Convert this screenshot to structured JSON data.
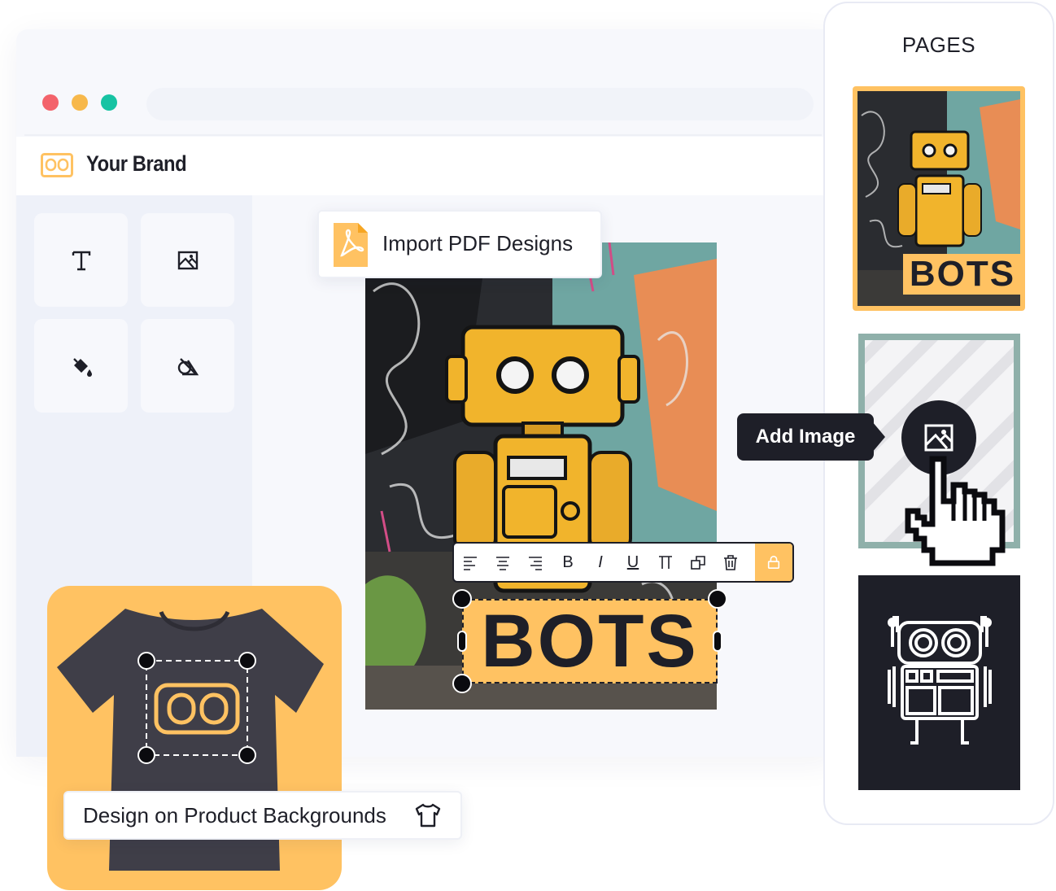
{
  "window": {
    "traffic_lights": [
      "#f3636b",
      "#f7b84b",
      "#17c3a3"
    ]
  },
  "brand": {
    "name": "Your Brand",
    "logo_icon": "robot-eyes-logo-icon",
    "accent": "#ffc262"
  },
  "sidebar": {
    "tools": [
      {
        "icon": "text-tool-icon",
        "glyph": "T"
      },
      {
        "icon": "image-tool-icon"
      },
      {
        "icon": "paint-bucket-icon"
      },
      {
        "icon": "shapes-icon"
      }
    ]
  },
  "import_chip": {
    "label": "Import PDF Designs",
    "icon": "pdf-file-icon"
  },
  "text_toolbar": {
    "buttons": [
      {
        "name": "align-left-button",
        "icon": "align-left-icon"
      },
      {
        "name": "align-center-button",
        "icon": "align-center-icon"
      },
      {
        "name": "align-right-button",
        "icon": "align-right-icon"
      },
      {
        "name": "bold-button",
        "label": "B"
      },
      {
        "name": "italic-button",
        "label": "I"
      },
      {
        "name": "underline-button",
        "label": "U"
      },
      {
        "name": "font-size-button",
        "icon": "text-height-icon"
      },
      {
        "name": "duplicate-button",
        "icon": "duplicate-icon"
      },
      {
        "name": "delete-button",
        "icon": "trash-icon"
      },
      {
        "name": "lock-button",
        "icon": "lock-icon"
      }
    ]
  },
  "canvas": {
    "text": "BOTS"
  },
  "product_chip": {
    "label": "Design on Product Backgrounds",
    "icon": "tshirt-icon"
  },
  "pages": {
    "title": "PAGES",
    "page_1_text": "BOTS",
    "add_image_label": "Add Image"
  }
}
